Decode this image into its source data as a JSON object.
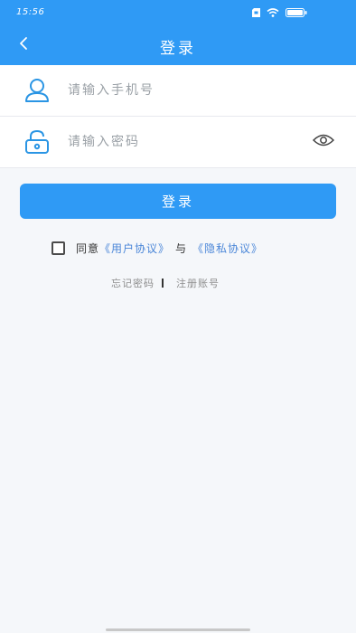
{
  "status_bar": {
    "time": "15:56",
    "icons": [
      "sd-card-icon",
      "wifi-icon",
      "battery-icon"
    ]
  },
  "nav": {
    "title": "登录",
    "back_icon": "chevron-left-icon"
  },
  "form": {
    "phone": {
      "icon": "user-icon",
      "placeholder": "请输入手机号",
      "value": ""
    },
    "password": {
      "icon": "lock-icon",
      "placeholder": "请输入密码",
      "value": "",
      "toggle_icon": "eye-icon"
    }
  },
  "login_button": {
    "label": "登录"
  },
  "agreement": {
    "checked": false,
    "prefix": "同意",
    "user_agreement": "《用户协议》",
    "connector": "与",
    "privacy_policy": "《隐私协议》"
  },
  "links": {
    "forgot_password": "忘记密码",
    "register": "注册账号"
  },
  "colors": {
    "primary": "#2f9af5",
    "link": "#4a86d8",
    "icon": "#2a95e4",
    "background": "#f5f7fa"
  }
}
